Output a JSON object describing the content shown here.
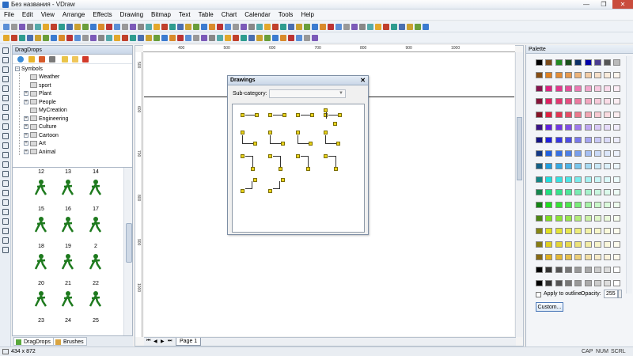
{
  "window": {
    "title": "Без названия - VDraw",
    "min": "—",
    "max": "❐",
    "close": "✕"
  },
  "menu": [
    "File",
    "Edit",
    "View",
    "Arrange",
    "Effects",
    "Drawing",
    "Bitmap",
    "Text",
    "Table",
    "Chart",
    "Calendar",
    "Tools",
    "Help"
  ],
  "dragdrops": {
    "title": "DragDrops",
    "tree": {
      "root": "Symbols",
      "children": [
        {
          "label": "Weather",
          "expandable": false
        },
        {
          "label": "sport",
          "expandable": false
        },
        {
          "label": "Plant",
          "expandable": true
        },
        {
          "label": "People",
          "expandable": true
        },
        {
          "label": "MyCreation",
          "expandable": false
        },
        {
          "label": "Engineering",
          "expandable": true
        },
        {
          "label": "Culture",
          "expandable": true
        },
        {
          "label": "Cartoon",
          "expandable": true
        },
        {
          "label": "Art",
          "expandable": true
        },
        {
          "label": "Animal",
          "expandable": true
        }
      ]
    },
    "grid_labels": [
      [
        "12",
        "13",
        "14"
      ],
      [
        "15",
        "16",
        "17"
      ],
      [
        "18",
        "19",
        "2"
      ],
      [
        "20",
        "21",
        "22"
      ],
      [
        "23",
        "24",
        "25"
      ]
    ],
    "tabs": [
      "DragDrops",
      "Brushes"
    ],
    "icon_color": "#1e7a1e"
  },
  "canvas": {
    "ruler_top": [
      "400",
      "500",
      "600",
      "700",
      "800",
      "900",
      "1000"
    ],
    "ruler_left": [
      "500",
      "600",
      "700",
      "800",
      "900",
      "1000"
    ],
    "page_tab": "Page 1",
    "nav": [
      "⏮",
      "◀",
      "▶",
      "⏭"
    ]
  },
  "dialog": {
    "title": "Drawings",
    "close": "✕",
    "subcategory_label": "Sub-category:",
    "subcategory_value": ""
  },
  "palette": {
    "title": "Palette",
    "apply_label": "Apply to outline",
    "opacity_label": "Opacity:",
    "opacity_value": "255",
    "custom_label": "Custom..."
  },
  "status": {
    "dimensions": "434 x 872",
    "keys": [
      "CAP",
      "NUM",
      "SCRL"
    ]
  }
}
